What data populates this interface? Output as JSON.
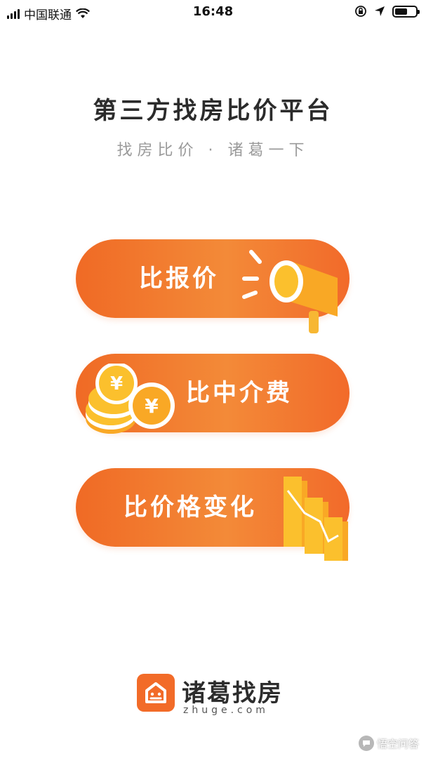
{
  "status_bar": {
    "carrier": "中国联通",
    "time": "16:48",
    "battery_percent": 60
  },
  "header": {
    "title": "第三方找房比价平台",
    "subtitle": "找房比价 · 诸葛一下"
  },
  "buttons": [
    {
      "label": "比报价",
      "icon": "megaphone-icon"
    },
    {
      "label": "比中介费",
      "icon": "yuan-coins-icon"
    },
    {
      "label": "比价格变化",
      "icon": "bar-chart-icon"
    }
  ],
  "logo": {
    "name": "诸葛找房",
    "url": "zhuge.com"
  },
  "watermark": {
    "text": "悟空问答"
  },
  "colors": {
    "accent": "#f26b28",
    "accent_light": "#f38a38",
    "icon_yellow": "#fbc02d",
    "title": "#2b2b2b",
    "subtitle": "#9a9a9a"
  }
}
